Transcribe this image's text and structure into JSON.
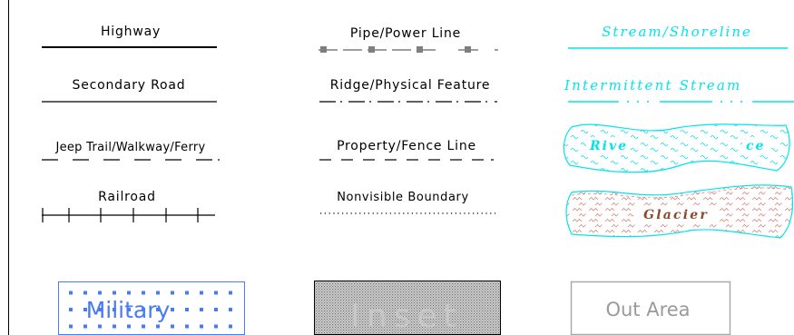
{
  "legend": {
    "highway": "Highway",
    "pipe_power_line": "Pipe/Power Line",
    "stream_shoreline": "Stream/Shoreline",
    "secondary_road": "Secondary Road",
    "ridge_physical_feature": "Ridge/Physical Feature",
    "intermittent_stream": "Intermittent Stream",
    "jeep_trail": "Jeep Trail/Walkway/Ferry",
    "property_fence_line": "Property/Fence Line",
    "river_lake": "River/Lake",
    "river_lake_fragments": [
      "Rive",
      "ce"
    ],
    "railroad": "Railroad",
    "nonvisible_boundary": "Nonvisible Boundary",
    "glacier": "Glacier",
    "military": "Military",
    "inset": "Inset",
    "out_area": "Out Area"
  },
  "colors": {
    "line": "#000000",
    "water": "#00e5ee",
    "glacier_text": "#8b4a2b",
    "glacier_wave": "#d08a80",
    "military": "#4a7cf0",
    "inset_fill": "#b8b8b8",
    "out_area": "#a9a9a9"
  }
}
